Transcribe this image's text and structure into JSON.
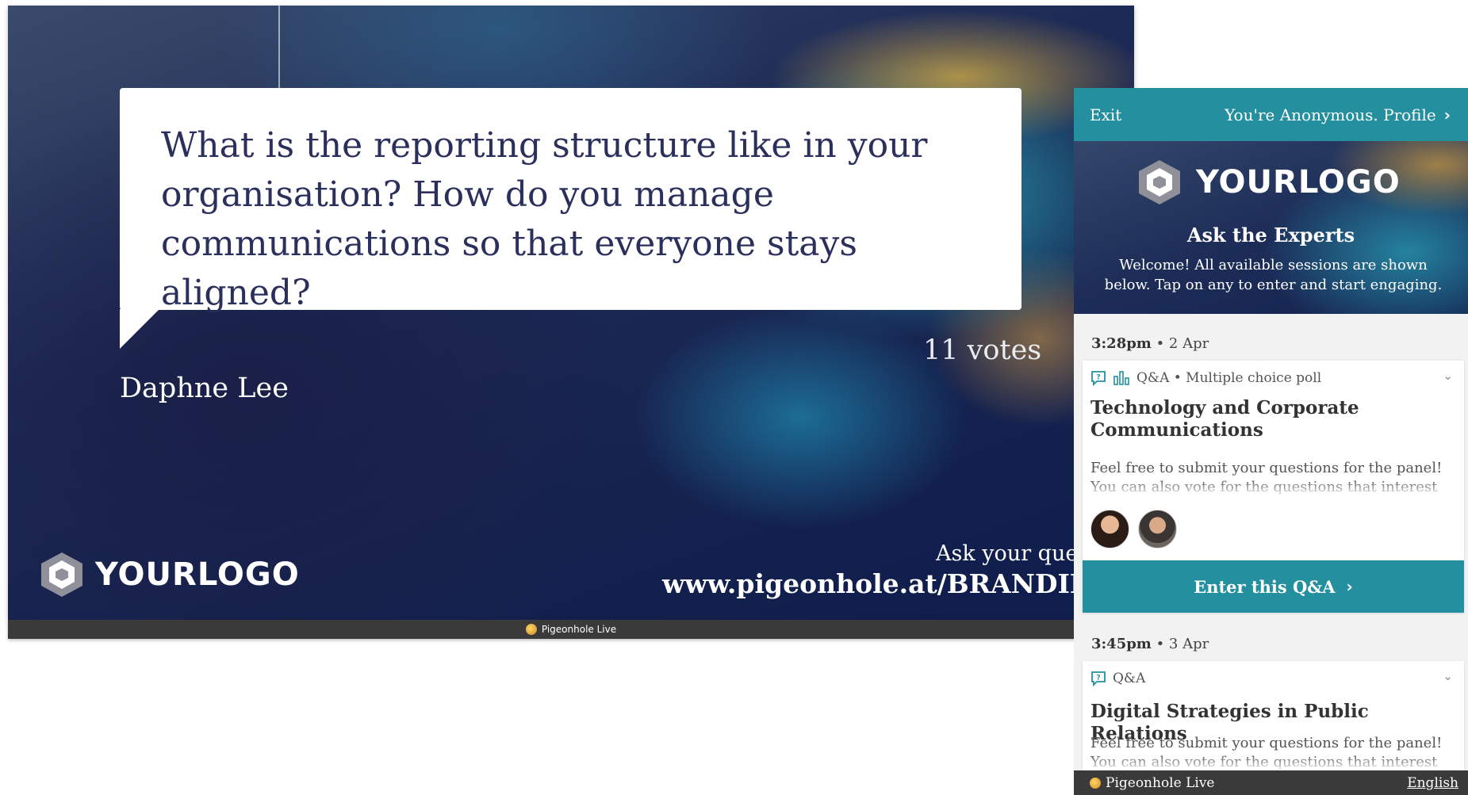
{
  "slide": {
    "question": "What is the reporting structure like in your organisation? How do you manage communications so that everyone stays aligned?",
    "author": "Daphne Lee",
    "votes": "11 votes",
    "logo_text": "YOURLOGO",
    "ask_prompt": "Ask your questi",
    "url": "www.pigeonhole.at/BRANDINGDE",
    "footer_label": "Pigeonhole Live"
  },
  "panel": {
    "exit_label": "Exit",
    "profile_label": "You're Anonymous. Profile",
    "logo_text": "YOURLOGO",
    "event_title": "Ask the Experts",
    "welcome_text": "Welcome! All available sessions are shown below. Tap on any to enter and start engaging.",
    "sessions": [
      {
        "time": "3:28pm",
        "date": "• 2 Apr",
        "type": "Q&A • Multiple choice poll",
        "title": "Technology and Corporate Communications",
        "description": "Feel free to submit your questions for the panel! You can also vote for the questions that interest you.",
        "button": "Enter this Q&A"
      },
      {
        "time": "3:45pm",
        "date": "• 3 Apr",
        "type": "Q&A",
        "title": "Digital Strategies in Public Relations",
        "description": "Feel free to submit your questions for the panel! You can also vote for the questions that interest you."
      }
    ],
    "footer_label": "Pigeonhole Live",
    "language": "English"
  },
  "colors": {
    "accent": "#24909f",
    "question_text": "#2b2f5c",
    "footer": "#3a3a3a"
  }
}
